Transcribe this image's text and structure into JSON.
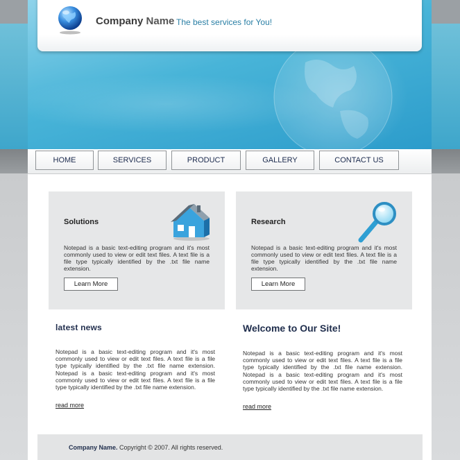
{
  "header": {
    "company_name": "Company",
    "company_name_2": "Name",
    "tagline": "The best services for You!"
  },
  "nav": {
    "items": [
      "HOME",
      "SERVICES",
      "PRODUCT",
      "GALLERY",
      "CONTACT US"
    ]
  },
  "boxes": [
    {
      "title": "Solutions",
      "text": "Notepad is a basic text-editing program and it's most commonly used to view or edit text files. A text file is a file type typically identified by the .txt file name extension.",
      "button": "Learn More",
      "icon": "house-icon"
    },
    {
      "title": "Research",
      "text": "Notepad is a basic text-editing program and it's most commonly used to view or edit text files. A text file is a file type typically identified by the .txt file name extension.",
      "button": "Learn More",
      "icon": "magnifier-icon"
    }
  ],
  "news": {
    "title": "latest news",
    "text": "Notepad is a basic text-editing program and it's most commonly used to view or edit text files. A text file is a file type typically identified by the .txt file name extension. Notepad is a basic text-editing program and it's most commonly used to view or edit text files. A text file is a file type typically identified by the .txt file name extension.",
    "read_more": "read more"
  },
  "welcome": {
    "title": "Welcome to Our Site!",
    "text": "Notepad is a basic text-editing program and it's most commonly used to view or edit text files. A text file is a file type typically identified by the .txt file name extension. Notepad is a basic text-editing program and it's most commonly used to view or edit text files. A text file is a file type typically identified by the .txt file name extension.",
    "read_more": "read more"
  },
  "footer": {
    "company": "Company Name.",
    "copyright": "Copyright © 2007. All rights reserved."
  },
  "colors": {
    "accent": "#2a7fa5",
    "banner": "#48b4d8",
    "nav_text": "#1b2a4d"
  }
}
